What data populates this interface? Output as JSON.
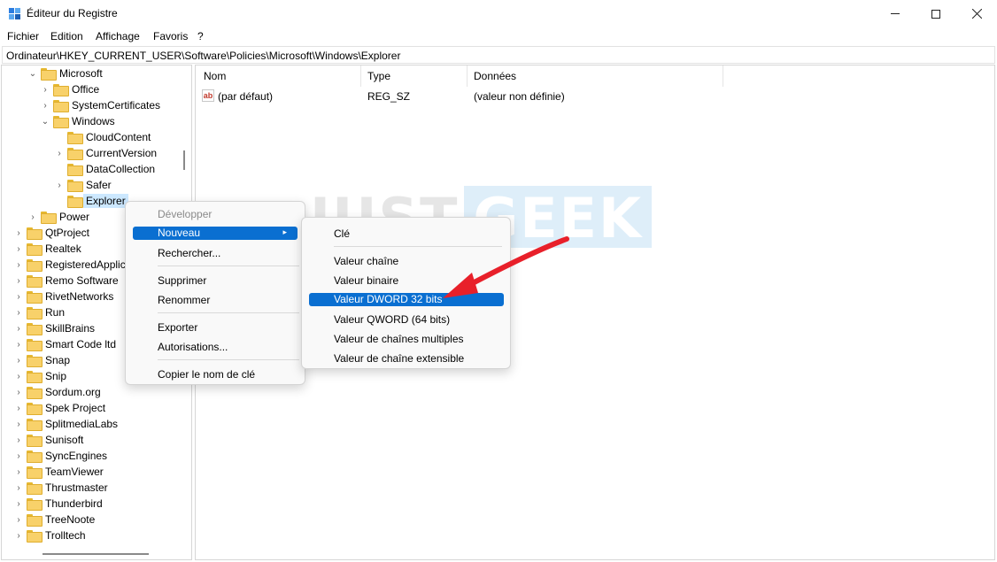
{
  "window": {
    "title": "Éditeur du Registre"
  },
  "menu": [
    "Fichier",
    "Edition",
    "Affichage",
    "Favoris",
    "?"
  ],
  "address": "Ordinateur\\HKEY_CURRENT_USER\\Software\\Policies\\Microsoft\\Windows\\Explorer",
  "tree": {
    "microsoft": "Microsoft",
    "office": "Office",
    "systemcertificates": "SystemCertificates",
    "windows": "Windows",
    "cloudcontent": "CloudContent",
    "currentversion": "CurrentVersion",
    "datacollection": "DataCollection",
    "safer": "Safer",
    "explorer": "Explorer",
    "power": "Power",
    "items": [
      "QtProject",
      "Realtek",
      "RegisteredApplica",
      "Remo Software",
      "RivetNetworks",
      "Run",
      "SkillBrains",
      "Smart Code ltd",
      "Snap",
      "Snip",
      "Sordum.org",
      "Spek Project",
      "SplitmediaLabs",
      "Sunisoft",
      "SyncEngines",
      "TeamViewer",
      "Thrustmaster",
      "Thunderbird",
      "TreeNoote",
      "Trolltech"
    ]
  },
  "values": {
    "headers": {
      "name": "Nom",
      "type": "Type",
      "data": "Données"
    },
    "rows": [
      {
        "icon": "ab",
        "name": "(par défaut)",
        "type": "REG_SZ",
        "data": "(valeur non définie)"
      }
    ]
  },
  "context_menu": {
    "developper": "Développer",
    "nouveau": "Nouveau",
    "rechercher": "Rechercher...",
    "supprimer": "Supprimer",
    "renommer": "Renommer",
    "exporter": "Exporter",
    "autorisations": "Autorisations...",
    "copier": "Copier le nom de clé"
  },
  "submenu": {
    "cle": "Clé",
    "chaine": "Valeur chaîne",
    "binaire": "Valeur binaire",
    "dword": "Valeur DWORD 32 bits",
    "qword": "Valeur QWORD (64 bits)",
    "multi": "Valeur de chaînes multiples",
    "extensible": "Valeur de chaîne extensible"
  },
  "watermark": {
    "part1": "JUST",
    "part2": "GEEK"
  },
  "colors": {
    "highlight": "#0a6fd1",
    "arrow": "#e8202a",
    "folder": "#f8d16a"
  }
}
